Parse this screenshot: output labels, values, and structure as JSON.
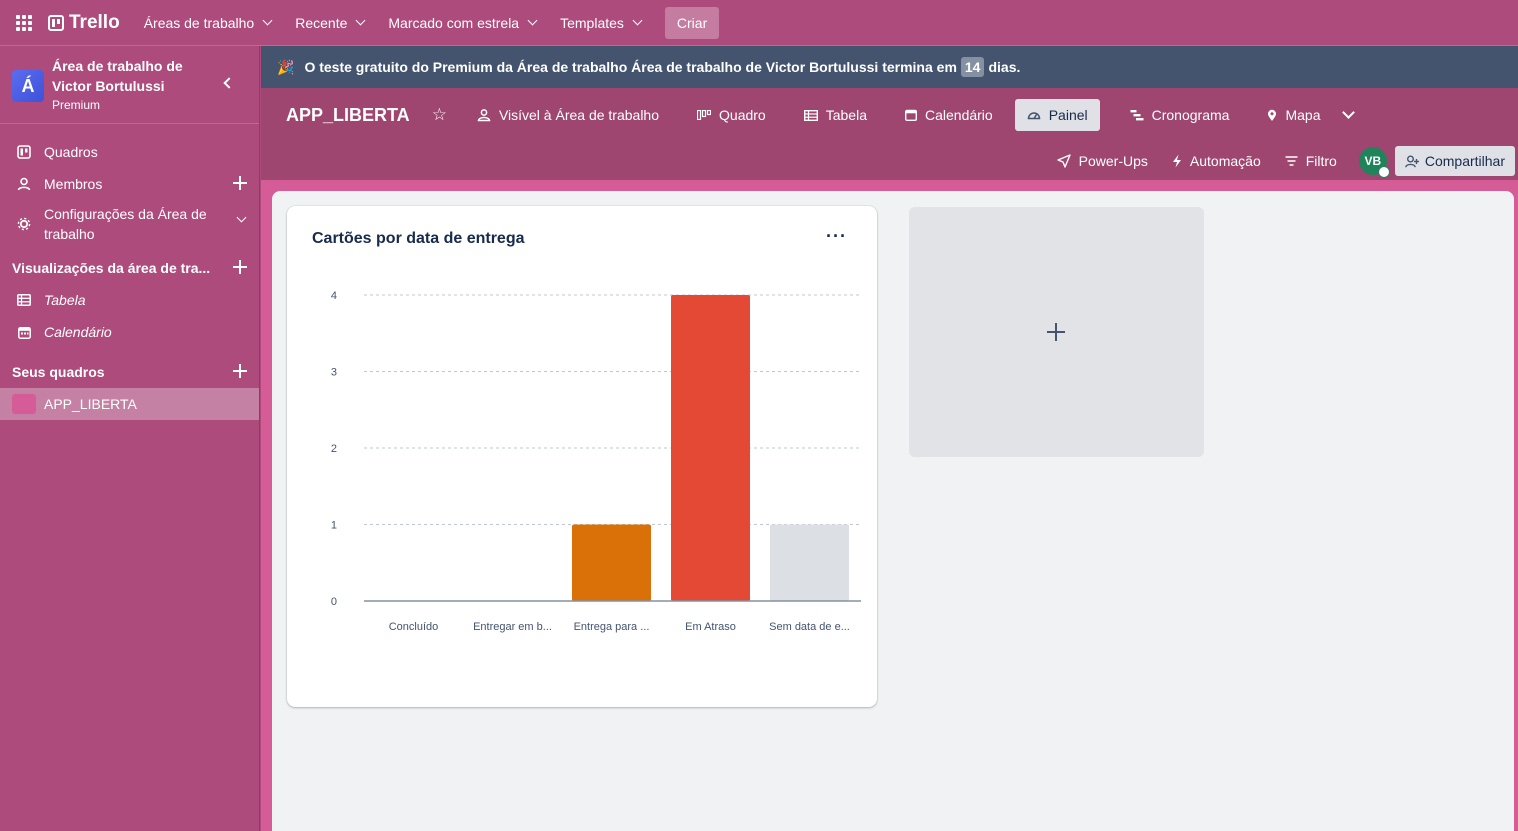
{
  "topnav": {
    "logo_text": "Trello",
    "items": [
      {
        "label": "Áreas de trabalho"
      },
      {
        "label": "Recente"
      },
      {
        "label": "Marcado com estrela"
      },
      {
        "label": "Templates"
      }
    ],
    "create_label": "Criar"
  },
  "sidebar": {
    "workspace_initial": "Á",
    "workspace_name": "Área de trabalho de Victor Bortulussi",
    "workspace_plan": "Premium",
    "items": [
      {
        "label": "Quadros"
      },
      {
        "label": "Membros"
      },
      {
        "label": "Configurações da Área de trabalho"
      }
    ],
    "views_section": "Visualizações da área de tra...",
    "views": [
      {
        "label": "Tabela"
      },
      {
        "label": "Calendário"
      }
    ],
    "boards_section": "Seus quadros",
    "boards": [
      {
        "label": "APP_LIBERTA",
        "color": "#d65c97"
      }
    ]
  },
  "banner": {
    "text_before": "O teste gratuito do Premium da Área de trabalho Área de trabalho de Victor Bortulussi termina em",
    "days": "14",
    "text_after": "dias."
  },
  "board": {
    "title": "APP_LIBERTA",
    "visibility_label": "Visível à Área de trabalho",
    "views": [
      {
        "label": "Quadro"
      },
      {
        "label": "Tabela"
      },
      {
        "label": "Calendário"
      },
      {
        "label": "Painel",
        "active": true
      },
      {
        "label": "Cronograma"
      },
      {
        "label": "Mapa"
      }
    ],
    "actions": [
      {
        "label": "Power-Ups"
      },
      {
        "label": "Automação"
      },
      {
        "label": "Filtro"
      }
    ],
    "member_initials": "VB",
    "share_label": "Compartilhar"
  },
  "colors": {
    "nav_bg": "#ad4b7c",
    "banner_bg": "#44546f",
    "board_header_bg": "#9e466f",
    "board_bg": "#d65c97"
  },
  "dashboard": {
    "chart_card_title": "Cartões por data de entrega",
    "menu_label": "···"
  },
  "chart_data": {
    "type": "bar",
    "title": "Cartões por data de entrega",
    "categories": [
      "Concluído",
      "Entregar em b...",
      "Entrega para ...",
      "Em Atraso",
      "Sem data de e..."
    ],
    "values": [
      0,
      0,
      1,
      4,
      1
    ],
    "colors": [
      "#1f845a",
      "#cf9f02",
      "#d97008",
      "#e34935",
      "#dcdfe4"
    ],
    "yticks": [
      0,
      1,
      2,
      3,
      4
    ],
    "ylim": [
      0,
      4
    ],
    "grid": true
  }
}
